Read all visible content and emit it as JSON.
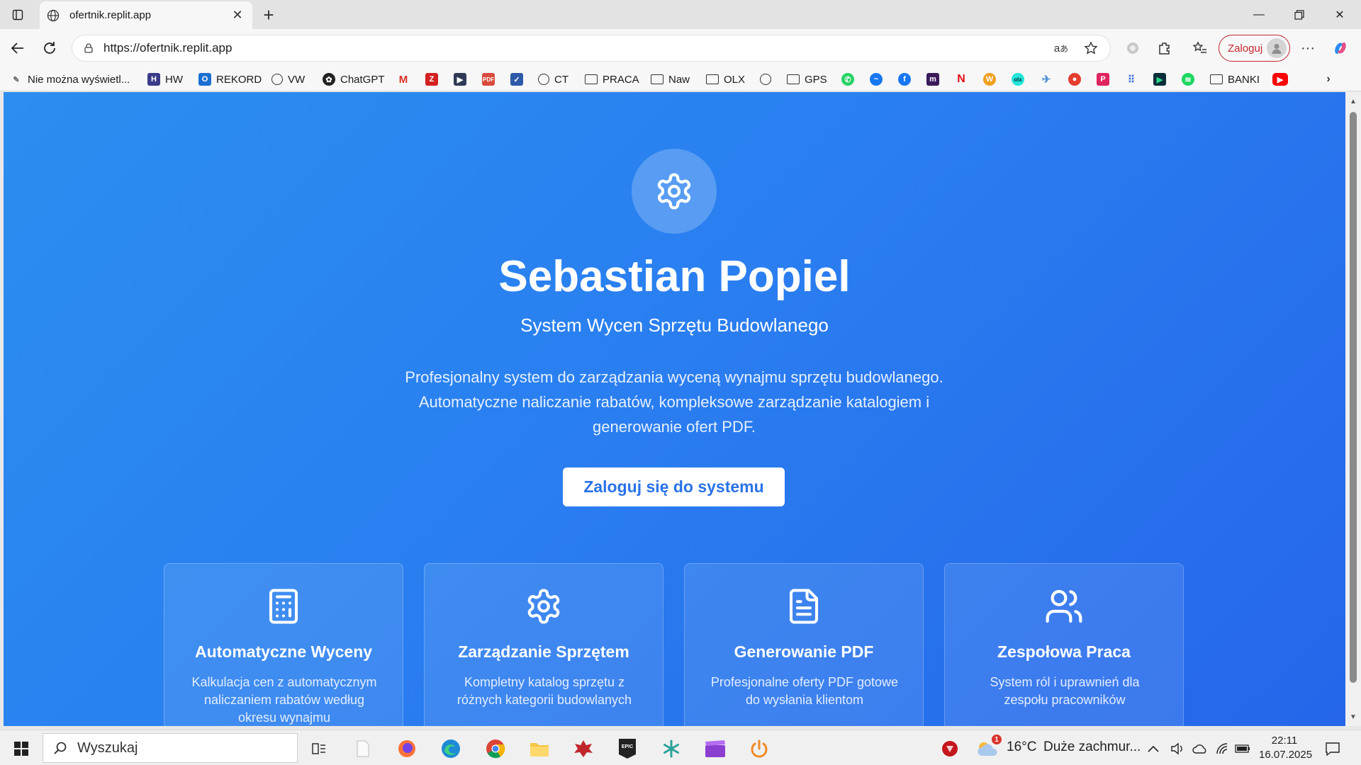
{
  "browser": {
    "tab_title": "ofertnik.replit.app",
    "url": "https://ofertnik.replit.app",
    "profile_button": "Zaloguj",
    "bookmarks": [
      {
        "label": "Nie można wyświetl...",
        "icon": "broken-image-icon"
      },
      {
        "label": "HW",
        "icon": "hw-icon"
      },
      {
        "label": "REKORD",
        "icon": "outlook-icon"
      },
      {
        "label": "VW",
        "icon": "globe-icon"
      },
      {
        "label": "ChatGPT",
        "icon": "chatgpt-icon"
      },
      {
        "label": "",
        "icon": "gmail-icon"
      },
      {
        "label": "",
        "icon": "z-icon"
      },
      {
        "label": "",
        "icon": "video-icon"
      },
      {
        "label": "",
        "icon": "pdf-jpg-icon"
      },
      {
        "label": "",
        "icon": "tool-icon"
      },
      {
        "label": "CT",
        "icon": "globe-icon"
      },
      {
        "label": "PRACA",
        "icon": "folder-icon"
      },
      {
        "label": "Naw",
        "icon": "folder-icon"
      },
      {
        "label": "OLX",
        "icon": "folder-icon"
      },
      {
        "label": "",
        "icon": "globe-icon"
      },
      {
        "label": "GPS",
        "icon": "folder-icon"
      },
      {
        "label": "",
        "icon": "whatsapp-icon"
      },
      {
        "label": "",
        "icon": "messenger-icon"
      },
      {
        "label": "",
        "icon": "facebook-icon"
      },
      {
        "label": "",
        "icon": "m-icon"
      },
      {
        "label": "",
        "icon": "netflix-icon"
      },
      {
        "label": "",
        "icon": "w-icon"
      },
      {
        "label": "",
        "icon": "olx-icon"
      },
      {
        "label": "",
        "icon": "tool2-icon"
      },
      {
        "label": "",
        "icon": "red-icon"
      },
      {
        "label": "",
        "icon": "p-icon"
      },
      {
        "label": "",
        "icon": "apps-grid-icon"
      },
      {
        "label": "",
        "icon": "play-icon"
      },
      {
        "label": "",
        "icon": "spotify-icon"
      },
      {
        "label": "BANKI",
        "icon": "folder-icon"
      },
      {
        "label": "",
        "icon": "youtube-icon"
      }
    ]
  },
  "page": {
    "title": "Sebastian Popiel",
    "subtitle": "System Wycen Sprzętu Budowlanego",
    "description": "Profesjonalny system do zarządzania wyceną wynajmu sprzętu budowlanego. Automatyczne naliczanie rabatów, kompleksowe zarządzanie katalogiem i generowanie ofert PDF.",
    "cta_label": "Zaloguj się do systemu",
    "features": [
      {
        "title": "Automatyczne Wyceny",
        "description": "Kalkulacja cen z automatycznym naliczaniem rabatów według okresu wynajmu",
        "icon": "calculator-icon"
      },
      {
        "title": "Zarządzanie Sprzętem",
        "description": "Kompletny katalog sprzętu z różnych kategorii budowlanych",
        "icon": "gear-icon"
      },
      {
        "title": "Generowanie PDF",
        "description": "Profesjonalne oferty PDF gotowe do wysłania klientom",
        "icon": "document-icon"
      },
      {
        "title": "Zespołowa Praca",
        "description": "System ról i uprawnień dla zespołu pracowników",
        "icon": "users-icon"
      }
    ]
  },
  "taskbar": {
    "search_placeholder": "Wyszukaj",
    "weather_temp": "16°C",
    "weather_desc": "Duże zachmur...",
    "weather_badge": "1",
    "time": "22:11",
    "date": "16.07.2025"
  },
  "colors": {
    "page_gradient_start": "#2b8ef0",
    "page_gradient_end": "#2566ea",
    "cta_text": "#2a72e8",
    "login_pill": "#c4262e"
  }
}
